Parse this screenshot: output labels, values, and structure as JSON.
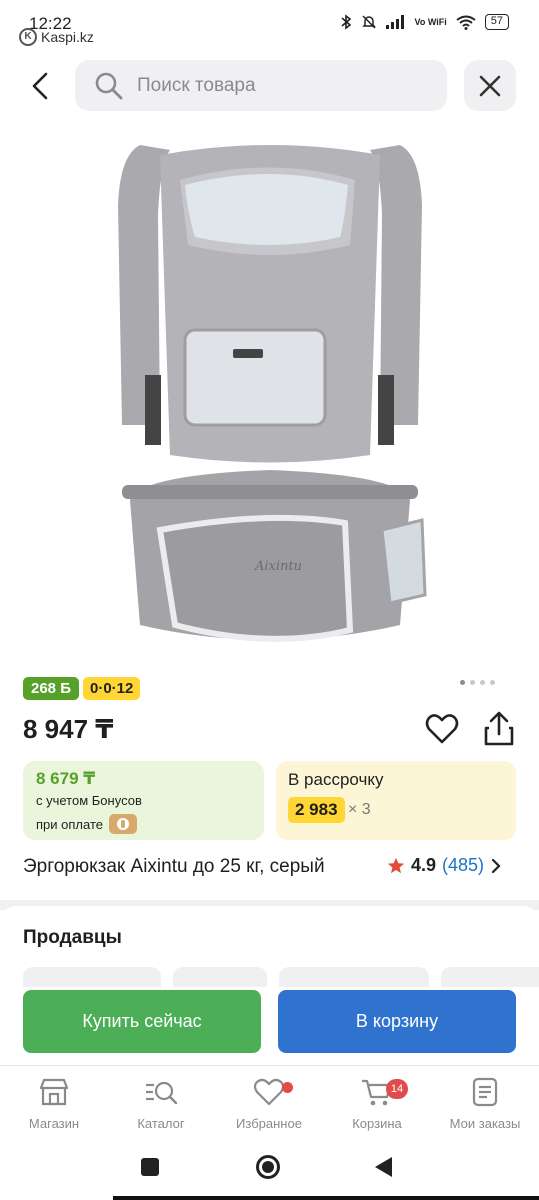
{
  "status_bar": {
    "time": "12:22",
    "app_label": "Kaspi.kz",
    "network_label": "Vo WiFi",
    "battery": "57"
  },
  "search": {
    "placeholder": "Поиск товара"
  },
  "product": {
    "image_name": "baby-carrier-photo",
    "image_brand_text": "Aixintu",
    "bonus_badge": "268 Б",
    "installment_badge": "0·0·12",
    "price": "8 947 ₸",
    "title": "Эргорюкзак Aixintu до 25 кг, серый",
    "rating": "4.9",
    "reviews": "(485)",
    "image_count": 4,
    "image_index": 1
  },
  "bonus_card": {
    "price": "8 679 ₸",
    "line1": "с учетом Бонусов",
    "line2": "при оплате"
  },
  "installment_card": {
    "title": "В рассрочку",
    "amount": "2 983",
    "multiplier": "× 3"
  },
  "sellers": {
    "title": "Продавцы"
  },
  "actions": {
    "buy_now": "Купить сейчас",
    "add_to_cart": "В корзину"
  },
  "bottom_nav": {
    "items": [
      {
        "label": "Магазин",
        "icon": "shop-icon"
      },
      {
        "label": "Каталог",
        "icon": "catalog-search-icon"
      },
      {
        "label": "Избранное",
        "icon": "heart-icon"
      },
      {
        "label": "Корзина",
        "icon": "cart-icon"
      },
      {
        "label": "Мои заказы",
        "icon": "orders-icon"
      }
    ],
    "cart_count": "14"
  },
  "colors": {
    "bonus_green": "#57a12b",
    "installment_yellow": "#ffd633",
    "buy_green": "#4caf58",
    "cart_blue": "#2f73cf",
    "link_blue": "#1a73c8",
    "badge_red": "#e24b4b"
  }
}
